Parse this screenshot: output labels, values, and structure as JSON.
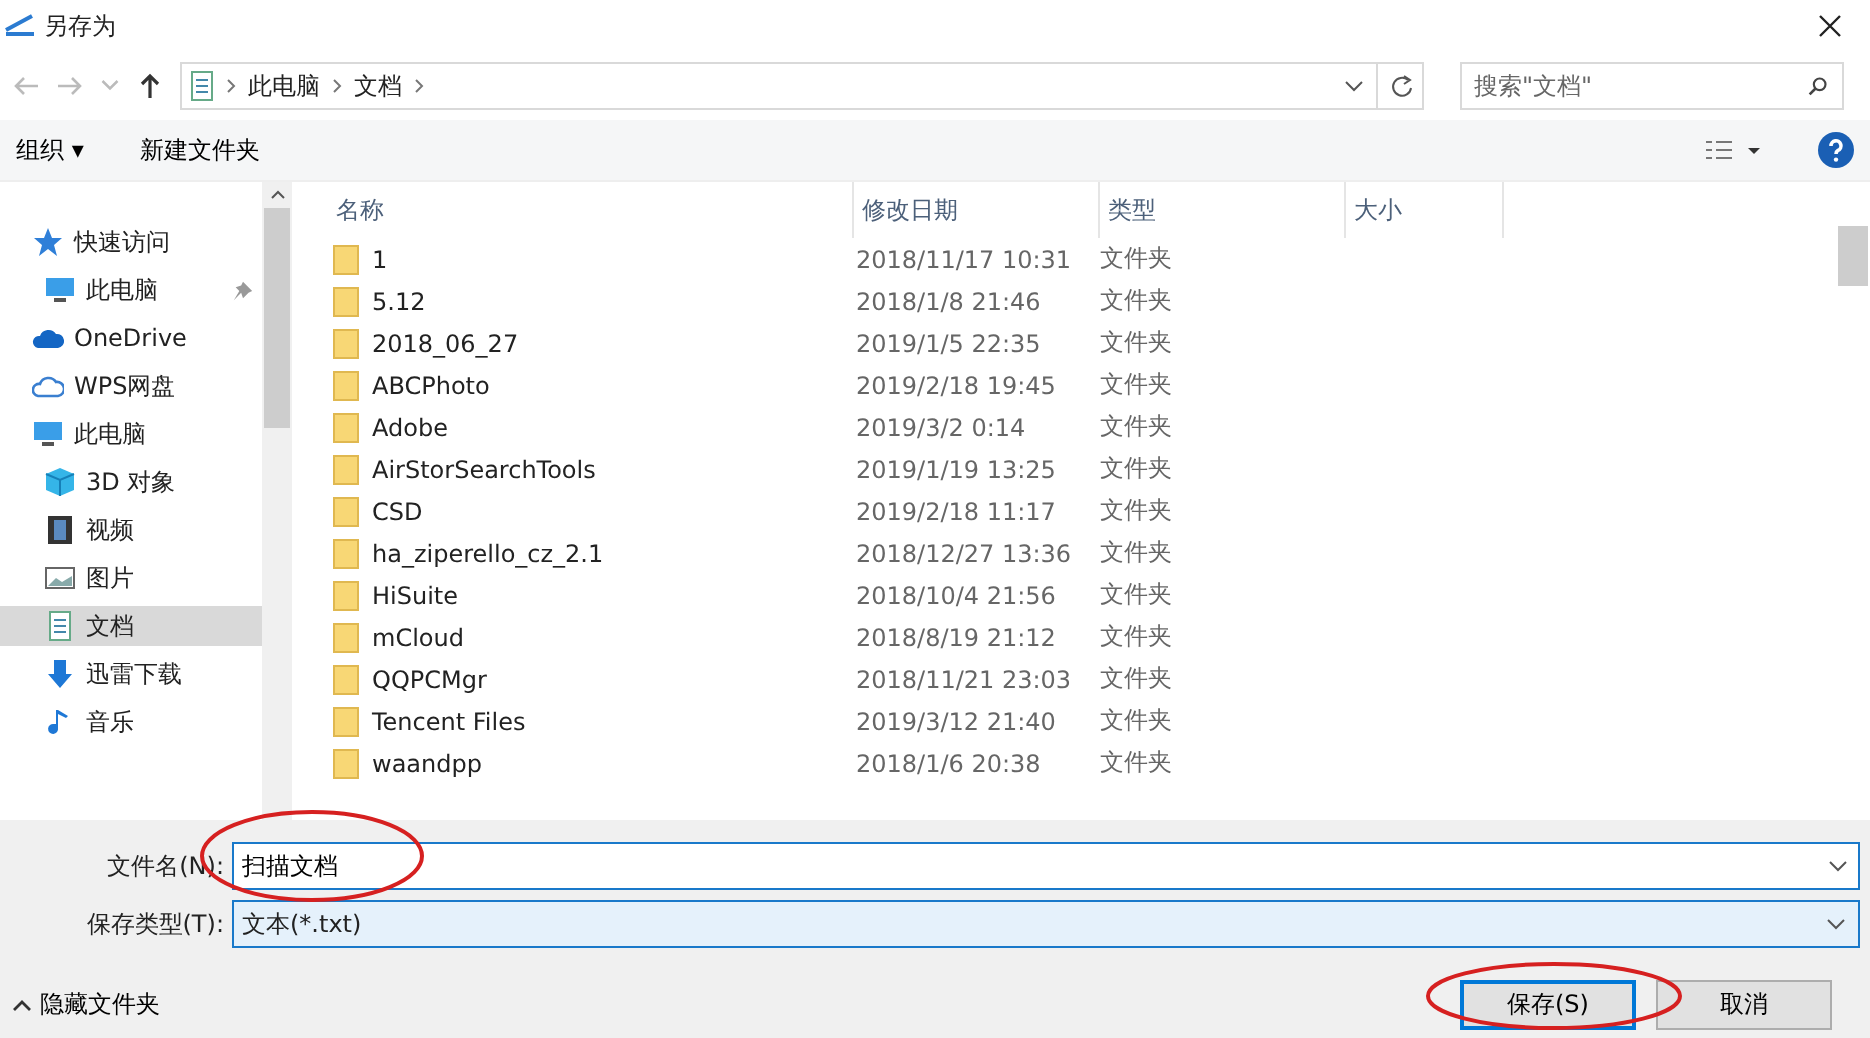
{
  "window": {
    "title": "另存为"
  },
  "address": {
    "crumbs": [
      "此电脑",
      "文档"
    ],
    "search_placeholder": "搜索\"文档\""
  },
  "toolbar": {
    "organize": "组织 ▾",
    "new_folder": "新建文件夹"
  },
  "sidebar": {
    "items": [
      {
        "label": "快速访问",
        "kind": "star",
        "selected": false,
        "pinned": false,
        "children": [
          {
            "label": "此电脑",
            "kind": "pc",
            "selected": false,
            "pinned": true
          }
        ]
      },
      {
        "label": "OneDrive",
        "kind": "cloud",
        "selected": false,
        "pinned": false
      },
      {
        "label": "WPS网盘",
        "kind": "cloud-outline",
        "selected": false,
        "pinned": false
      },
      {
        "label": "此电脑",
        "kind": "pc",
        "selected": false,
        "pinned": false,
        "children": [
          {
            "label": "3D 对象",
            "kind": "cube",
            "selected": false,
            "pinned": false
          },
          {
            "label": "视频",
            "kind": "film",
            "selected": false,
            "pinned": false
          },
          {
            "label": "图片",
            "kind": "picture",
            "selected": false,
            "pinned": false
          },
          {
            "label": "文档",
            "kind": "doc",
            "selected": true,
            "pinned": false
          },
          {
            "label": "迅雷下载",
            "kind": "download",
            "selected": false,
            "pinned": false
          },
          {
            "label": "音乐",
            "kind": "music",
            "selected": false,
            "pinned": false
          }
        ]
      }
    ]
  },
  "table": {
    "columns": [
      "名称",
      "修改日期",
      "类型",
      "大小"
    ],
    "rows": [
      {
        "name": "1",
        "date": "2018/11/17 10:31",
        "type": "文件夹"
      },
      {
        "name": "5.12",
        "date": "2018/1/8 21:46",
        "type": "文件夹"
      },
      {
        "name": "2018_06_27",
        "date": "2019/1/5 22:35",
        "type": "文件夹"
      },
      {
        "name": "ABCPhoto",
        "date": "2019/2/18 19:45",
        "type": "文件夹"
      },
      {
        "name": "Adobe",
        "date": "2019/3/2 0:14",
        "type": "文件夹"
      },
      {
        "name": "AirStorSearchTools",
        "date": "2019/1/19 13:25",
        "type": "文件夹"
      },
      {
        "name": "CSD",
        "date": "2019/2/18 11:17",
        "type": "文件夹"
      },
      {
        "name": "ha_ziperello_cz_2.1",
        "date": "2018/12/27 13:36",
        "type": "文件夹"
      },
      {
        "name": "HiSuite",
        "date": "2018/10/4 21:56",
        "type": "文件夹"
      },
      {
        "name": "mCloud",
        "date": "2018/8/19 21:12",
        "type": "文件夹"
      },
      {
        "name": "QQPCMgr",
        "date": "2018/11/21 23:03",
        "type": "文件夹"
      },
      {
        "name": "Tencent Files",
        "date": "2019/3/12 21:40",
        "type": "文件夹"
      },
      {
        "name": "waandpp",
        "date": "2018/1/6 20:38",
        "type": "文件夹"
      }
    ]
  },
  "form": {
    "filename_label": "文件名(N):",
    "filename": "扫描文档",
    "type_label": "保存类型(T):",
    "type_value": "文本(*.txt)"
  },
  "footer": {
    "hide_folders": "隐藏文件夹",
    "save": "保存(S)",
    "cancel": "取消"
  }
}
